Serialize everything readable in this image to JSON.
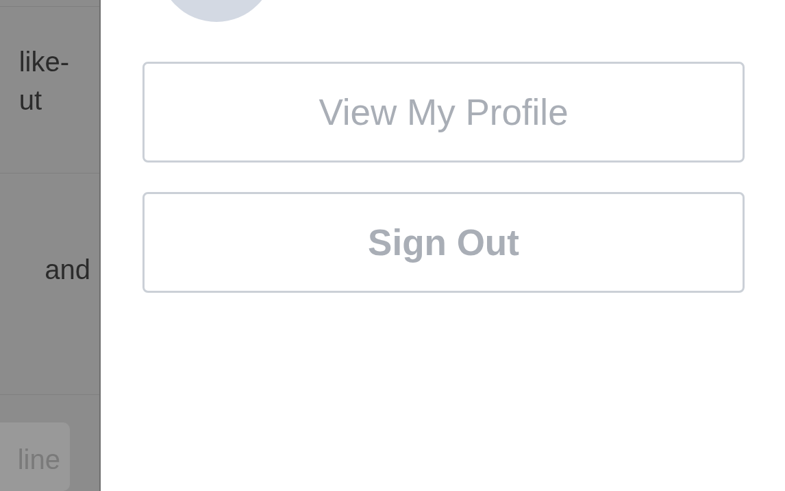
{
  "background_list": {
    "items": [
      {
        "text": "like-\nut"
      },
      {
        "text": "and"
      }
    ],
    "button": "line"
  },
  "account_menu": {
    "buttons": [
      {
        "label": "View My Profile",
        "kind": "profile"
      },
      {
        "label": "Sign Out",
        "kind": "signout"
      }
    ]
  }
}
